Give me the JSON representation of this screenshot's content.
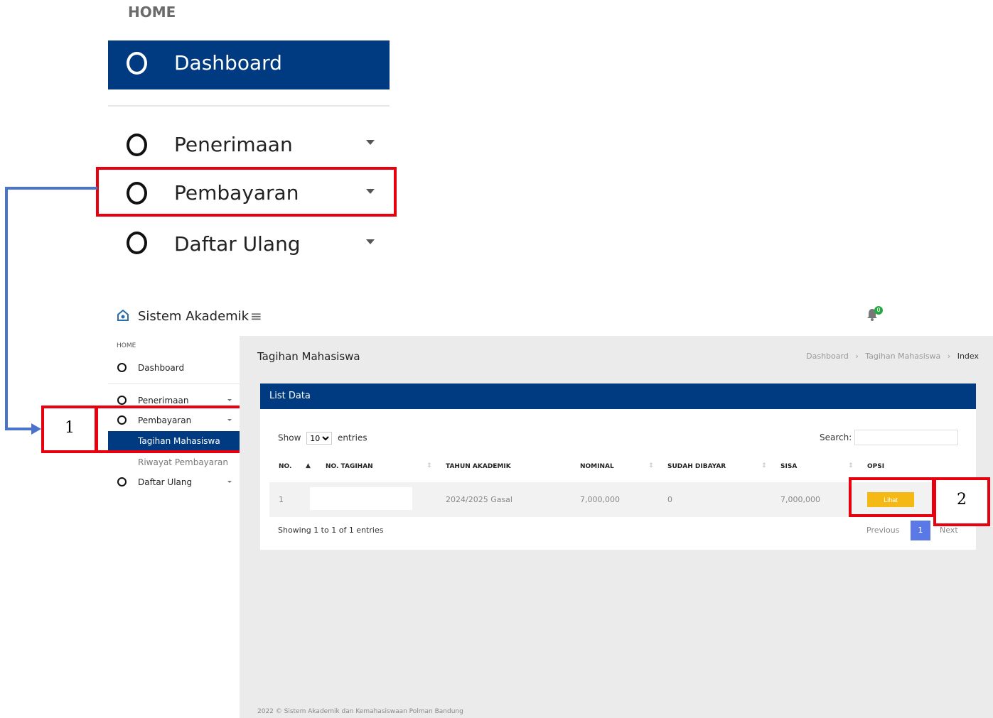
{
  "zoom": {
    "home": "HOME",
    "dashboard": "Dashboard",
    "items": [
      {
        "label": "Penerimaan"
      },
      {
        "label": "Pembayaran"
      },
      {
        "label": "Daftar Ulang"
      }
    ]
  },
  "callouts": {
    "one": "1",
    "two": "2"
  },
  "header": {
    "title": "Sistem Akademik",
    "notification_count": "0",
    "hamburger": "≡"
  },
  "sidebar": {
    "home": "HOME",
    "dashboard": "Dashboard",
    "penerimaan": "Penerimaan",
    "pembayaran": "Pembayaran",
    "active_sub": "Tagihan Mahasiswa",
    "sub2": "Riwayat Pembayaran",
    "daftar_ulang": "Daftar Ulang"
  },
  "page": {
    "title": "Tagihan Mahasiswa",
    "breadcrumb": [
      "Dashboard",
      "Tagihan Mahasiswa",
      "Index"
    ],
    "breadcrumb_sep": "›"
  },
  "card": {
    "title": "List Data",
    "show_label": "Show",
    "entries_value": "10",
    "entries_label": "entries",
    "search_label": "Search:",
    "columns": [
      "NO.",
      "NO. TAGIHAN",
      "TAHUN AKADEMIK",
      "NOMINAL",
      "SUDAH DIBAYAR",
      "SISA",
      "OPSI"
    ],
    "row": {
      "no": "1",
      "no_tagihan": "",
      "tahun": "2024/2025 Gasal",
      "nominal": "7,000,000",
      "dibayar": "0",
      "sisa": "7,000,000",
      "action": "Lihat"
    },
    "showing": "Showing 1 to 1 of 1 entries",
    "prev": "Previous",
    "page": "1",
    "next": "Next"
  },
  "footer": "2022 © Sistem Akademik dan Kemahasiswaan Polman Bandung",
  "colors": {
    "primary": "#003a80",
    "highlight": "#e8000f",
    "arrow": "#4a74c9",
    "button": "#f5b916",
    "pagination": "#5a78e6"
  }
}
